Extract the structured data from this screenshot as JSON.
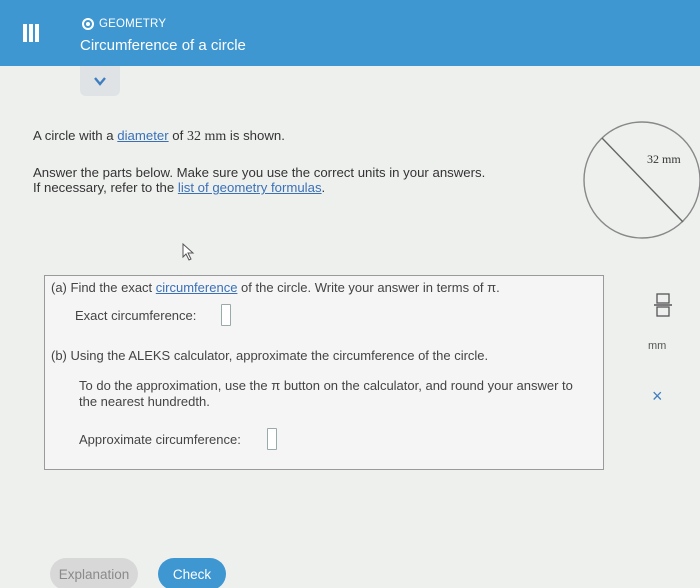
{
  "header": {
    "subject": "GEOMETRY",
    "topic": "Circumference of a circle",
    "color": "#3f97d2"
  },
  "problem": {
    "line1_prefix": "A circle with a ",
    "line1_link": "diameter",
    "line1_mid": " of ",
    "line1_value": "32 mm",
    "line1_suffix": " is shown.",
    "line2": "Answer the parts below. Make sure you use the correct units in your answers.",
    "line3_prefix": "If necessary, refer to the ",
    "line3_link": "list of geometry formulas",
    "line3_suffix": "."
  },
  "figure": {
    "diameter_label": "32 mm"
  },
  "part_a": {
    "prefix": "(a) Find the exact ",
    "link": "circumference",
    "suffix": " of the circle. Write your answer in terms of π.",
    "field_label": "Exact circumference:"
  },
  "part_b": {
    "text": "(b) Using the ALEKS calculator, approximate the circumference of the circle.",
    "instruction": "To do the approximation, use the π button on the calculator, and round your answer to the nearest hundredth.",
    "field_label": "Approximate circumference:"
  },
  "tools": {
    "unit": "mm",
    "clear": "×"
  },
  "buttons": {
    "explanation": "Explanation",
    "check": "Check"
  }
}
